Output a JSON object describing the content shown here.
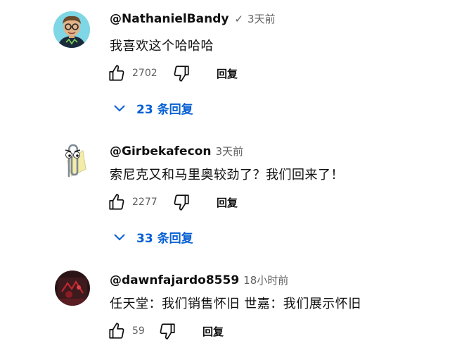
{
  "comments": [
    {
      "username": "@NathanielBandy",
      "verified_mark": "✓",
      "time": "3天前",
      "text": "我喜欢这个哈哈哈",
      "likes": "2702",
      "reply_label": "回复",
      "replies_toggle": "23 条回复",
      "avatar_icon": "cartoon-man-with-glasses-avatar"
    },
    {
      "username": "@Girbekafecon",
      "time": "3天前",
      "text": "索尼克又和马里奥较劲了？我们回来了！",
      "likes": "2277",
      "reply_label": "回复",
      "replies_toggle": "33 条回复",
      "avatar_icon": "paperclip-assistant-avatar"
    },
    {
      "username": "@dawnfajardo8559",
      "time": "18小时前",
      "text": "任天堂：我们销售怀旧 世嘉：我们展示怀旧",
      "likes": "59",
      "reply_label": "回复",
      "avatar_icon": "dark-red-photo-avatar"
    }
  ],
  "colors": {
    "link_blue": "#065fd4",
    "secondary_text": "#606060",
    "primary_text": "#0f0f0f"
  }
}
